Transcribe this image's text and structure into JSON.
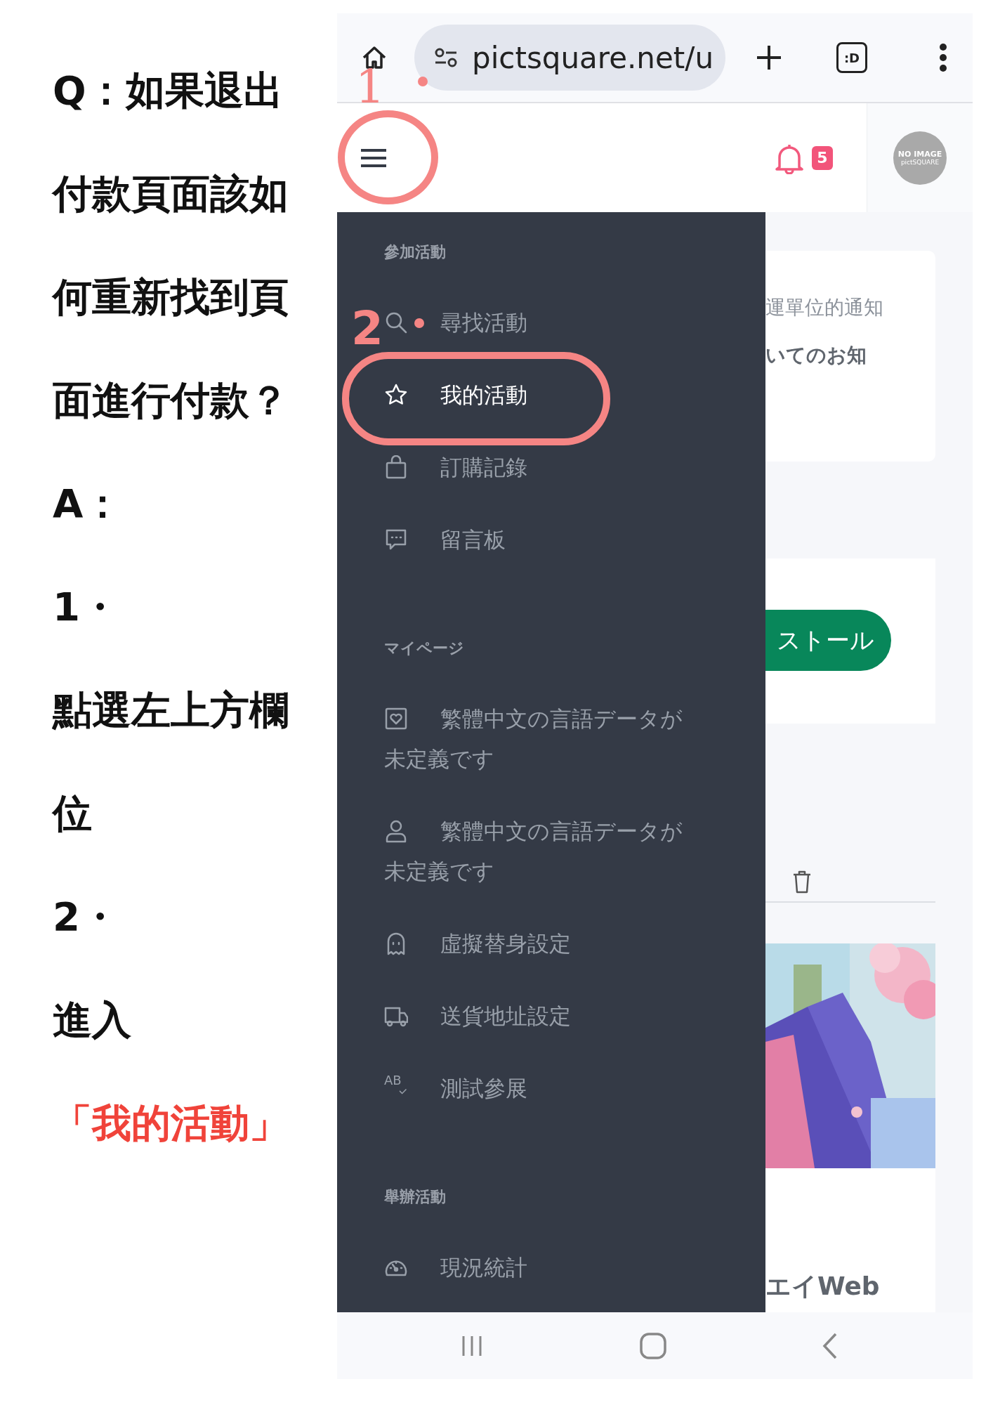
{
  "tutorial": {
    "lines": [
      {
        "text": "Q：如果退出",
        "highlight": false
      },
      {
        "text": "付款頁面該如",
        "highlight": false
      },
      {
        "text": "何重新找到頁",
        "highlight": false
      },
      {
        "text": "面進行付款？",
        "highlight": false
      },
      {
        "text": "A：",
        "highlight": false
      },
      {
        "text": "1・",
        "highlight": false
      },
      {
        "text": "點選左上方欄",
        "highlight": false
      },
      {
        "text": "位",
        "highlight": false
      },
      {
        "text": "2・",
        "highlight": false
      },
      {
        "text": "進入",
        "highlight": false
      },
      {
        "text": "「我的活動」",
        "highlight": true
      }
    ]
  },
  "browser": {
    "url": "pictsquare.net/u",
    "tab_icon_text": ":D"
  },
  "annotations": [
    {
      "label": "1"
    },
    {
      "label": "2"
    }
  ],
  "header": {
    "notification_count": "5",
    "avatar": {
      "text": "NO IMAGE",
      "subtext": "pictSQUARE"
    }
  },
  "drawer": {
    "sections": [
      {
        "heading": "參加活動",
        "items": [
          {
            "label": "尋找活動",
            "selected": false
          },
          {
            "label": "我的活動",
            "selected": true
          },
          {
            "label": "訂購記錄",
            "selected": false
          },
          {
            "label": "留言板",
            "selected": false
          }
        ]
      },
      {
        "heading": "マイページ",
        "items": [
          {
            "label": "繁體中文の言語データが未定義です",
            "selected": false
          },
          {
            "label": "繁體中文の言語データが未定義です",
            "selected": false
          },
          {
            "label": "虛擬替身設定",
            "selected": false
          },
          {
            "label": "送貨地址設定",
            "selected": false
          },
          {
            "label": "測試參展",
            "selected": false,
            "icon_label": "AB"
          }
        ]
      },
      {
        "heading": "舉辦活動",
        "items": [
          {
            "label": "現況統計",
            "selected": false
          }
        ]
      }
    ]
  },
  "background": {
    "notice_card": {
      "line_1": "運單位的通知",
      "line_2": "いてのお知"
    },
    "button": "ストール",
    "picture_card": {
      "kind": "picture",
      "title": "エイWeb"
    }
  }
}
